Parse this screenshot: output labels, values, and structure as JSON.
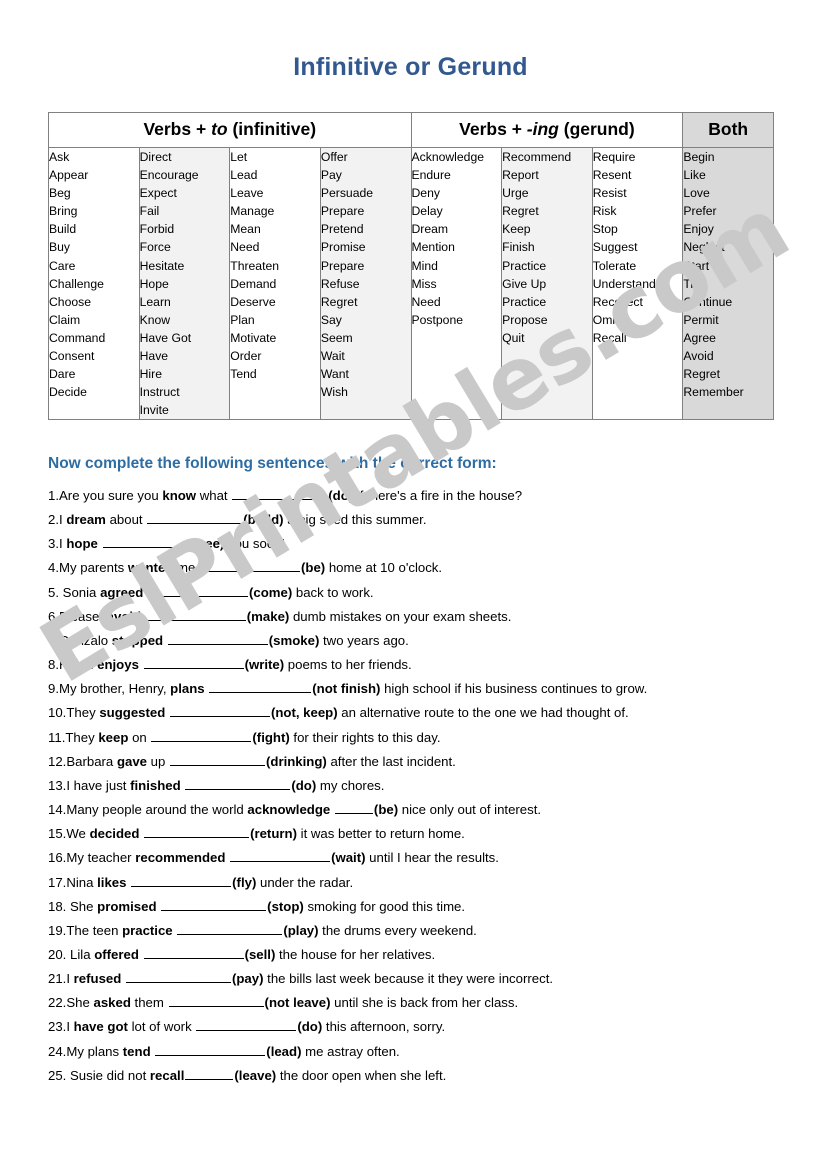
{
  "page": {
    "title": "Infinitive or Gerund",
    "watermark": "EslPrintables.com"
  },
  "verbs_table": {
    "headers": [
      {
        "label_plain_1": "Verbs + ",
        "label_italic": "to",
        "label_plain_2": " (infinitive)",
        "span": 4,
        "shaded": false
      },
      {
        "label_plain_1": "Verbs + ",
        "label_italic": "-ing",
        "label_plain_2": " (gerund)",
        "span": 3,
        "shaded": false
      },
      {
        "label_plain_1": "Both",
        "label_italic": "",
        "label_plain_2": "",
        "span": 1,
        "shaded": true
      }
    ],
    "columns": [
      {
        "shade": "none",
        "items": [
          "Ask",
          "Appear",
          "Beg",
          "Bring",
          "Build",
          "Buy",
          "Care",
          "Challenge",
          "Choose",
          "Claim",
          "Command",
          "Consent",
          "Dare",
          "Decide"
        ]
      },
      {
        "shade": "lite",
        "items": [
          "Direct",
          "Encourage",
          "Expect",
          "Fail",
          "Forbid",
          "Force",
          "Hesitate",
          "Hope",
          "Learn",
          "Know",
          "Have Got",
          "Have",
          "Hire",
          "Instruct",
          "Invite"
        ]
      },
      {
        "shade": "none",
        "items": [
          "Let",
          "Lead",
          "Leave",
          "Manage",
          "Mean",
          "Need",
          "Threaten",
          "Demand",
          "Deserve",
          "Plan",
          "Motivate",
          "Order",
          "Tend"
        ]
      },
      {
        "shade": "lite",
        "items": [
          "Offer",
          "Pay",
          "Persuade",
          "Prepare",
          "Pretend",
          "Promise",
          "Prepare",
          "Refuse",
          "Regret",
          "Say",
          "Seem",
          "Wait",
          "Want",
          "Wish"
        ]
      },
      {
        "shade": "none",
        "items": [
          "Acknowledge",
          "Endure",
          "Deny",
          "Delay",
          "Dream",
          "Mention",
          "Mind",
          "Miss",
          "Need",
          "Postpone"
        ]
      },
      {
        "shade": "lite",
        "items": [
          "Recommend",
          "Report",
          "Urge",
          "Regret",
          "Keep",
          "Finish",
          "Practice",
          "Give Up",
          "Practice",
          "Propose",
          "Quit"
        ]
      },
      {
        "shade": "none",
        "items": [
          "Require",
          "Resent",
          "Resist",
          "Risk",
          "Stop",
          "Suggest",
          "Tolerate",
          "Understand",
          "Recollect",
          "Omit",
          "Recall"
        ]
      },
      {
        "shade": "dark",
        "items": [
          "Begin",
          "Like",
          "Love",
          "Prefer",
          "Enjoy",
          "Neglect",
          "Start",
          "Try",
          "Continue",
          "Permit",
          "Agree",
          "Avoid",
          "Regret",
          "Remember"
        ]
      }
    ]
  },
  "exercise": {
    "instruction": "Now complete the following sentences with the correct form:",
    "items": [
      {
        "number": "1.",
        "pre": "Are you sure you ",
        "bold1": "know",
        "mid": " what ",
        "blank": 95,
        "cue": "(do)",
        "post": " if there's a fire in the house?"
      },
      {
        "number": "2.",
        "pre": "I ",
        "bold1": "dream",
        "mid": " about ",
        "blank": 95,
        "cue": "(build)",
        "post": " a big shed this summer."
      },
      {
        "number": "3.",
        "pre": "I ",
        "bold1": "hope",
        "mid": " ",
        "blank": 90,
        "cue": "(see)",
        "post": " you soon!"
      },
      {
        "number": "4.",
        "pre": "My parents ",
        "bold1": "wanted",
        "mid": " me ",
        "blank": 100,
        "cue": "(be)",
        "post": " home at 10 o'clock."
      },
      {
        "number": "5.",
        "pre": " Sonia ",
        "bold1": "agreed",
        "mid": "   ",
        "blank": 100,
        "cue": "(come)",
        "post": " back to work."
      },
      {
        "number": "6.",
        "pre": "Please, ",
        "bold1": "avoid",
        "mid": " ",
        "blank": 100,
        "cue": "(make)",
        "post": " dumb mistakes on your exam sheets."
      },
      {
        "number": "7.",
        "pre": "Gonzalo ",
        "bold1": "stopped",
        "mid": " ",
        "blank": 100,
        "cue": "(smoke)",
        "post": " two years ago."
      },
      {
        "number": "8.",
        "pre": "Helen ",
        "bold1": "enjoys",
        "mid": " ",
        "blank": 100,
        "cue": "(write)",
        "post": " poems to her friends."
      },
      {
        "number": "9.",
        "pre": "My brother, Henry, ",
        "bold1": "plans",
        "mid": " ",
        "blank": 102,
        "cue": "(not finish)",
        "post": " high school if his business continues to grow."
      },
      {
        "number": "10.",
        "pre": "They ",
        "bold1": "suggested",
        "mid": " ",
        "blank": 100,
        "cue": "(not, keep)",
        "post": " an alternative route to the one we had thought of."
      },
      {
        "number": "11.",
        "pre": "They ",
        "bold1": "keep",
        "mid": " on ",
        "blank": 100,
        "cue": "(fight)",
        "post": " for their rights to this day."
      },
      {
        "number": "12.",
        "pre": "Barbara ",
        "bold1": "gave",
        "mid": " up ",
        "blank": 95,
        "cue": "(drinking)",
        "post": " after the last incident."
      },
      {
        "number": "13.",
        "pre": "I have just ",
        "bold1": "finished",
        "mid": " ",
        "blank": 105,
        "cue": "(do)",
        "post": " my chores."
      },
      {
        "number": "14.",
        "pre": "Many people around the world ",
        "bold1": "acknowledge",
        "mid": " ",
        "blank": 38,
        "cue": "(be)",
        "post": " nice only out of interest."
      },
      {
        "number": "15.",
        "pre": "We ",
        "bold1": "decided",
        "mid": " ",
        "blank": 105,
        "cue": "(return)",
        "post": " it was better to return home."
      },
      {
        "number": "16.",
        "pre": "My teacher ",
        "bold1": "recommended",
        "mid": " ",
        "blank": 100,
        "cue": "(wait)",
        "post": " until I hear the results."
      },
      {
        "number": "17.",
        "pre": "Nina ",
        "bold1": "likes",
        "mid": " ",
        "blank": 100,
        "cue": "(fly)",
        "post": " under the radar."
      },
      {
        "number": "18.",
        "pre": " She ",
        "bold1": "promised",
        "mid": " ",
        "blank": 105,
        "cue": "(stop)",
        "post": " smoking for good this time."
      },
      {
        "number": "19.",
        "pre": "The teen ",
        "bold1": "practice",
        "mid": " ",
        "blank": 105,
        "cue": "(play)",
        "post": " the drums every weekend."
      },
      {
        "number": "20.",
        "pre": " Lila ",
        "bold1": "offered",
        "mid": " ",
        "blank": 100,
        "cue": "(sell)",
        "post": " the house for her relatives."
      },
      {
        "number": "21.",
        "pre": "I ",
        "bold1": "refused",
        "mid": " ",
        "blank": 105,
        "cue": "(pay)",
        "post": " the bills last week because it they were incorrect."
      },
      {
        "number": "22.",
        "pre": "She ",
        "bold1": "asked",
        "mid": " them ",
        "blank": 95,
        "cue": "(not leave)",
        "post": " until she is back from her class."
      },
      {
        "number": "23.",
        "pre": "I ",
        "bold1": "have got",
        "mid": " lot of work ",
        "blank": 100,
        "cue": "(do)",
        "post": " this afternoon, sorry."
      },
      {
        "number": "24.",
        "pre": "My plans ",
        "bold1": "tend",
        "mid": " ",
        "blank": 110,
        "cue": "(lead)",
        "post": " me astray often."
      },
      {
        "number": "25.",
        "pre": " Susie did not ",
        "bold1": "recall",
        "mid": "",
        "blank": 48,
        "cue": "(leave)",
        "post": " the door open when she left."
      }
    ]
  },
  "colors": {
    "title": "#32598f",
    "instruction": "#2e6da4",
    "table_border": "#808080",
    "column_shade_light": "#f2f2f2",
    "column_shade_dark": "#d9d9d9",
    "watermark": "#c9c9c9"
  }
}
